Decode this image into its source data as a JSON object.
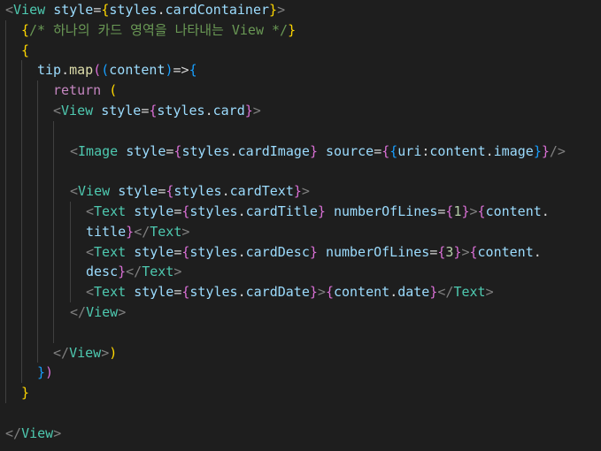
{
  "editor": {
    "lines": [
      {
        "indent": 0,
        "tokens": [
          {
            "t": "<",
            "c": "punc"
          },
          {
            "t": "View",
            "c": "tag"
          },
          {
            "t": " "
          },
          {
            "t": "style",
            "c": "attr"
          },
          {
            "t": "=",
            "c": "op"
          },
          {
            "t": "{",
            "c": "b1"
          },
          {
            "t": "styles",
            "c": "var"
          },
          {
            "t": ".",
            "c": "op"
          },
          {
            "t": "cardContainer",
            "c": "var"
          },
          {
            "t": "}",
            "c": "b1"
          },
          {
            "t": ">",
            "c": "punc"
          }
        ]
      },
      {
        "indent": 1,
        "tokens": [
          {
            "t": "{",
            "c": "b1"
          },
          {
            "t": "/* 하나의 카드 영역을 나타내는 View */",
            "c": "cmt"
          },
          {
            "t": "}",
            "c": "b1"
          }
        ]
      },
      {
        "indent": 1,
        "tokens": [
          {
            "t": "{",
            "c": "b1"
          }
        ]
      },
      {
        "indent": 2,
        "tokens": [
          {
            "t": "tip",
            "c": "var"
          },
          {
            "t": ".",
            "c": "op"
          },
          {
            "t": "map",
            "c": "fn"
          },
          {
            "t": "(",
            "c": "b2"
          },
          {
            "t": "(",
            "c": "b3"
          },
          {
            "t": "content",
            "c": "var"
          },
          {
            "t": ")",
            "c": "b3"
          },
          {
            "t": "=>",
            "c": "op"
          },
          {
            "t": "{",
            "c": "b3"
          }
        ]
      },
      {
        "indent": 3,
        "tokens": [
          {
            "t": "return",
            "c": "kw"
          },
          {
            "t": " "
          },
          {
            "t": "(",
            "c": "b1"
          }
        ]
      },
      {
        "indent": 3,
        "tokens": [
          {
            "t": "<",
            "c": "punc"
          },
          {
            "t": "View",
            "c": "tag"
          },
          {
            "t": " "
          },
          {
            "t": "style",
            "c": "attr"
          },
          {
            "t": "=",
            "c": "op"
          },
          {
            "t": "{",
            "c": "b2"
          },
          {
            "t": "styles",
            "c": "var"
          },
          {
            "t": ".",
            "c": "op"
          },
          {
            "t": "card",
            "c": "var"
          },
          {
            "t": "}",
            "c": "b2"
          },
          {
            "t": ">",
            "c": "punc"
          }
        ]
      },
      {
        "indent": 0,
        "tokens": []
      },
      {
        "indent": 4,
        "tokens": [
          {
            "t": "<",
            "c": "punc"
          },
          {
            "t": "Image",
            "c": "tag"
          },
          {
            "t": " "
          },
          {
            "t": "style",
            "c": "attr"
          },
          {
            "t": "=",
            "c": "op"
          },
          {
            "t": "{",
            "c": "b2"
          },
          {
            "t": "styles",
            "c": "var"
          },
          {
            "t": ".",
            "c": "op"
          },
          {
            "t": "cardImage",
            "c": "var"
          },
          {
            "t": "}",
            "c": "b2"
          },
          {
            "t": " "
          },
          {
            "t": "source",
            "c": "attr"
          },
          {
            "t": "=",
            "c": "op"
          },
          {
            "t": "{",
            "c": "b2"
          },
          {
            "t": "{",
            "c": "b3"
          },
          {
            "t": "uri",
            "c": "var"
          },
          {
            "t": ":",
            "c": "op"
          },
          {
            "t": "content",
            "c": "var"
          },
          {
            "t": ".",
            "c": "op"
          },
          {
            "t": "image",
            "c": "var"
          },
          {
            "t": "}",
            "c": "b3"
          },
          {
            "t": "}",
            "c": "b2"
          },
          {
            "t": "/>",
            "c": "punc"
          }
        ]
      },
      {
        "indent": 0,
        "tokens": []
      },
      {
        "indent": 4,
        "tokens": [
          {
            "t": "<",
            "c": "punc"
          },
          {
            "t": "View",
            "c": "tag"
          },
          {
            "t": " "
          },
          {
            "t": "style",
            "c": "attr"
          },
          {
            "t": "=",
            "c": "op"
          },
          {
            "t": "{",
            "c": "b2"
          },
          {
            "t": "styles",
            "c": "var"
          },
          {
            "t": ".",
            "c": "op"
          },
          {
            "t": "cardText",
            "c": "var"
          },
          {
            "t": "}",
            "c": "b2"
          },
          {
            "t": ">",
            "c": "punc"
          }
        ]
      },
      {
        "indent": 5,
        "tokens": [
          {
            "t": "<",
            "c": "punc"
          },
          {
            "t": "Text",
            "c": "tag"
          },
          {
            "t": " "
          },
          {
            "t": "style",
            "c": "attr"
          },
          {
            "t": "=",
            "c": "op"
          },
          {
            "t": "{",
            "c": "b2"
          },
          {
            "t": "styles",
            "c": "var"
          },
          {
            "t": ".",
            "c": "op"
          },
          {
            "t": "cardTitle",
            "c": "var"
          },
          {
            "t": "}",
            "c": "b2"
          },
          {
            "t": " "
          },
          {
            "t": "numberOfLines",
            "c": "attr"
          },
          {
            "t": "=",
            "c": "op"
          },
          {
            "t": "{",
            "c": "b2"
          },
          {
            "t": "1",
            "c": "num"
          },
          {
            "t": "}",
            "c": "b2"
          },
          {
            "t": ">",
            "c": "punc"
          },
          {
            "t": "{",
            "c": "b2"
          },
          {
            "t": "content",
            "c": "var"
          },
          {
            "t": ".",
            "c": "op"
          }
        ]
      },
      {
        "indent": 5,
        "tokens": [
          {
            "t": "title",
            "c": "var"
          },
          {
            "t": "}",
            "c": "b2"
          },
          {
            "t": "</",
            "c": "punc"
          },
          {
            "t": "Text",
            "c": "tag"
          },
          {
            "t": ">",
            "c": "punc"
          }
        ]
      },
      {
        "indent": 5,
        "tokens": [
          {
            "t": "<",
            "c": "punc"
          },
          {
            "t": "Text",
            "c": "tag"
          },
          {
            "t": " "
          },
          {
            "t": "style",
            "c": "attr"
          },
          {
            "t": "=",
            "c": "op"
          },
          {
            "t": "{",
            "c": "b2"
          },
          {
            "t": "styles",
            "c": "var"
          },
          {
            "t": ".",
            "c": "op"
          },
          {
            "t": "cardDesc",
            "c": "var"
          },
          {
            "t": "}",
            "c": "b2"
          },
          {
            "t": " "
          },
          {
            "t": "numberOfLines",
            "c": "attr"
          },
          {
            "t": "=",
            "c": "op"
          },
          {
            "t": "{",
            "c": "b2"
          },
          {
            "t": "3",
            "c": "num"
          },
          {
            "t": "}",
            "c": "b2"
          },
          {
            "t": ">",
            "c": "punc"
          },
          {
            "t": "{",
            "c": "b2"
          },
          {
            "t": "content",
            "c": "var"
          },
          {
            "t": ".",
            "c": "op"
          }
        ]
      },
      {
        "indent": 5,
        "tokens": [
          {
            "t": "desc",
            "c": "var"
          },
          {
            "t": "}",
            "c": "b2"
          },
          {
            "t": "</",
            "c": "punc"
          },
          {
            "t": "Text",
            "c": "tag"
          },
          {
            "t": ">",
            "c": "punc"
          }
        ]
      },
      {
        "indent": 5,
        "tokens": [
          {
            "t": "<",
            "c": "punc"
          },
          {
            "t": "Text",
            "c": "tag"
          },
          {
            "t": " "
          },
          {
            "t": "style",
            "c": "attr"
          },
          {
            "t": "=",
            "c": "op"
          },
          {
            "t": "{",
            "c": "b2"
          },
          {
            "t": "styles",
            "c": "var"
          },
          {
            "t": ".",
            "c": "op"
          },
          {
            "t": "cardDate",
            "c": "var"
          },
          {
            "t": "}",
            "c": "b2"
          },
          {
            "t": ">",
            "c": "punc"
          },
          {
            "t": "{",
            "c": "b2"
          },
          {
            "t": "content",
            "c": "var"
          },
          {
            "t": ".",
            "c": "op"
          },
          {
            "t": "date",
            "c": "var"
          },
          {
            "t": "}",
            "c": "b2"
          },
          {
            "t": "</",
            "c": "punc"
          },
          {
            "t": "Text",
            "c": "tag"
          },
          {
            "t": ">",
            "c": "punc"
          }
        ]
      },
      {
        "indent": 4,
        "tokens": [
          {
            "t": "</",
            "c": "punc"
          },
          {
            "t": "View",
            "c": "tag"
          },
          {
            "t": ">",
            "c": "punc"
          }
        ]
      },
      {
        "indent": 0,
        "tokens": []
      },
      {
        "indent": 3,
        "tokens": [
          {
            "t": "</",
            "c": "punc"
          },
          {
            "t": "View",
            "c": "tag"
          },
          {
            "t": ">",
            "c": "punc"
          },
          {
            "t": ")",
            "c": "b1"
          }
        ]
      },
      {
        "indent": 2,
        "tokens": [
          {
            "t": "}",
            "c": "b3"
          },
          {
            "t": ")",
            "c": "b2"
          }
        ]
      },
      {
        "indent": 1,
        "tokens": [
          {
            "t": "}",
            "c": "b1"
          }
        ]
      },
      {
        "indent": 0,
        "tokens": []
      },
      {
        "indent": 0,
        "tokens": [
          {
            "t": "</",
            "c": "punc"
          },
          {
            "t": "View",
            "c": "tag"
          },
          {
            "t": ">",
            "c": "punc"
          }
        ]
      }
    ]
  }
}
